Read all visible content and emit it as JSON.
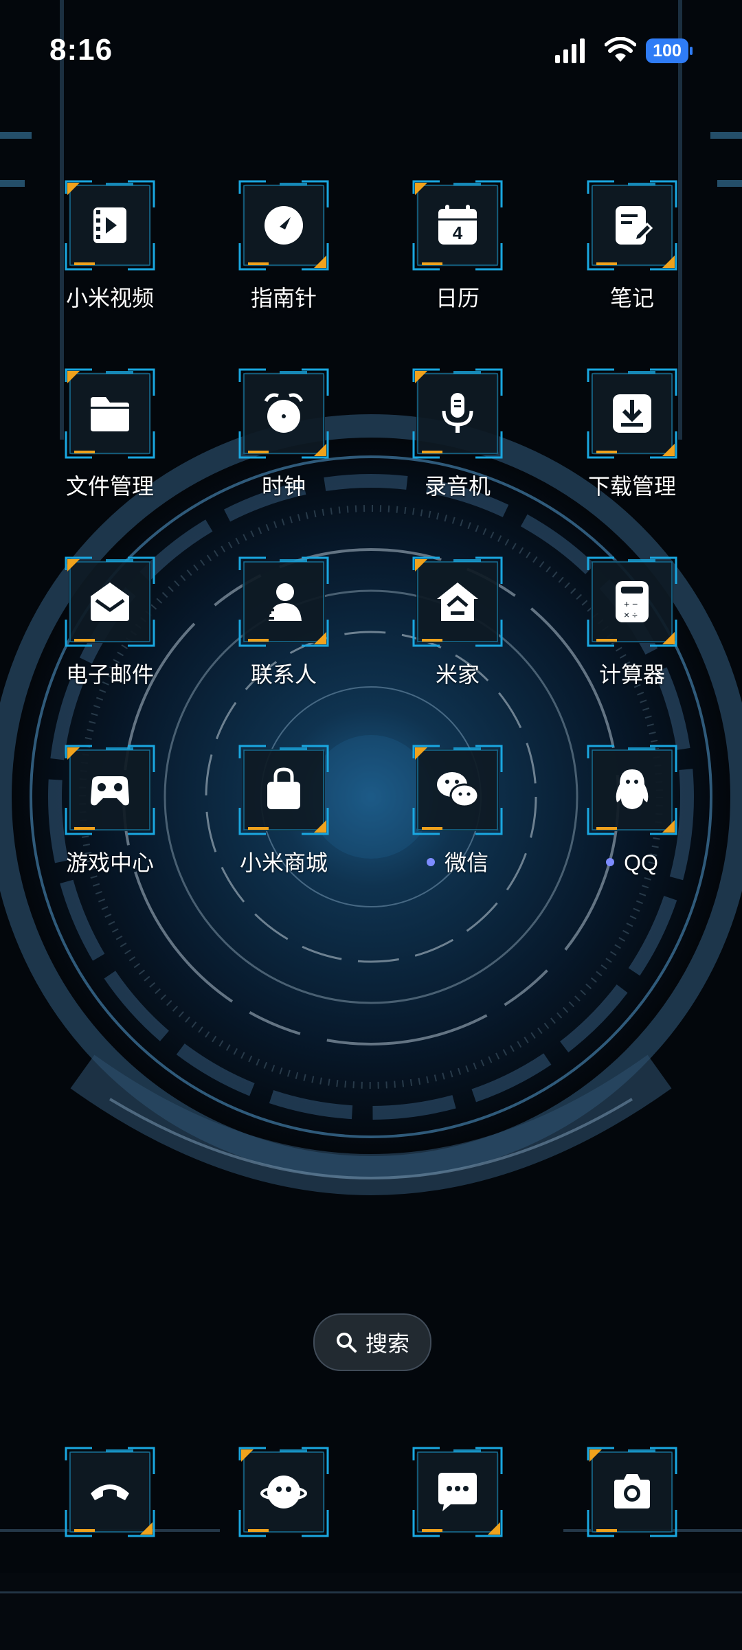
{
  "status_bar": {
    "time": "8:16",
    "battery": "100",
    "battery_color": "#2f7cf6",
    "icons": [
      "signal-icon",
      "wifi-icon",
      "battery-icon"
    ]
  },
  "theme": {
    "accent": "#1aa7e0",
    "highlight": "#f0a21c",
    "icon_bg": "#0e1a24"
  },
  "apps": [
    {
      "label": "小米视频",
      "icon": "video-icon"
    },
    {
      "label": "指南针",
      "icon": "compass-icon"
    },
    {
      "label": "日历",
      "icon": "calendar-icon",
      "badge_text": "4"
    },
    {
      "label": "笔记",
      "icon": "notes-icon"
    },
    {
      "label": "文件管理",
      "icon": "folder-icon"
    },
    {
      "label": "时钟",
      "icon": "alarm-clock-icon"
    },
    {
      "label": "录音机",
      "icon": "microphone-icon"
    },
    {
      "label": "下载管理",
      "icon": "download-icon"
    },
    {
      "label": "电子邮件",
      "icon": "mail-icon"
    },
    {
      "label": "联系人",
      "icon": "contacts-icon"
    },
    {
      "label": "米家",
      "icon": "home-icon"
    },
    {
      "label": "计算器",
      "icon": "calculator-icon"
    },
    {
      "label": "游戏中心",
      "icon": "gamepad-icon"
    },
    {
      "label": "小米商城",
      "icon": "shopping-bag-icon"
    },
    {
      "label": "微信",
      "icon": "wechat-icon",
      "new_dot": true
    },
    {
      "label": "QQ",
      "icon": "qq-penguin-icon",
      "new_dot": true
    }
  ],
  "search": {
    "label": "搜索",
    "icon": "search-icon"
  },
  "dock": [
    {
      "icon": "phone-icon"
    },
    {
      "icon": "browser-planet-icon"
    },
    {
      "icon": "message-icon"
    },
    {
      "icon": "camera-icon"
    }
  ]
}
